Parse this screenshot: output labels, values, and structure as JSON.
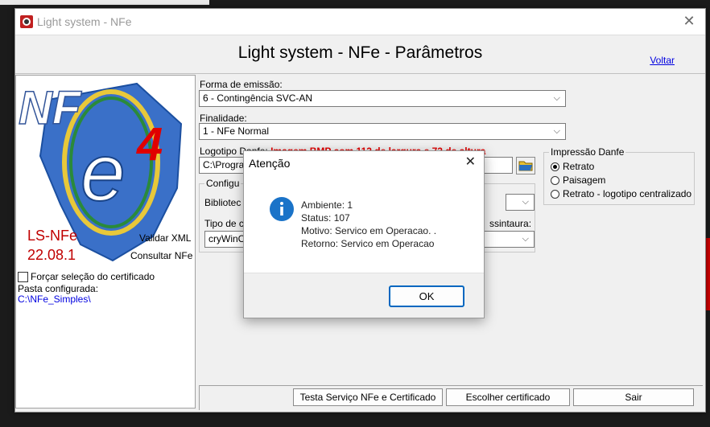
{
  "window": {
    "title": "Light system - NFe"
  },
  "header": {
    "title": "Light system - NFe - Parâmetros",
    "back_link": "Voltar"
  },
  "logo": {
    "big": "NF",
    "version_digit": "4",
    "product": "LS-NFe",
    "version": "22.08.1",
    "validate_link": "Validar XML",
    "consult_link": "Consultar NFe"
  },
  "left": {
    "force_cert": "Forçar seleção do certificado",
    "folder_label": "Pasta configurada:",
    "folder_value": "C:\\NFe_Simples\\"
  },
  "form": {
    "emissao_label": "Forma de emissão:",
    "emissao_value": "6 - Contingência SVC-AN",
    "finalidade_label": "Finalidade:",
    "finalidade_value": "1 - NFe Normal",
    "logotipo_label": "Logotipo Danfe:",
    "logotipo_hint": "Imagem BMP com 112 de largura e 72 de altura",
    "logotipo_path": "C:\\Progra",
    "config_group": "Configu",
    "biblioteca_label": "Bibliotec",
    "tipo_label": "Tipo de c",
    "assinatura_label": "ssintaura:",
    "assinatura_value": "cryWinC"
  },
  "danfe": {
    "title": "Impressão Danfe",
    "options": [
      "Retrato",
      "Paisagem",
      "Retrato - logotipo centralizado"
    ],
    "selected": 0
  },
  "buttons": {
    "test": "Testa Serviço NFe e Certificado",
    "choose_cert": "Escolher certificado",
    "exit": "Sair"
  },
  "dialog": {
    "title": "Atenção",
    "lines": [
      "Ambiente: 1",
      "Status: 107",
      "Motivo: Servico em Operacao. .",
      "Retorno: Servico em Operacao"
    ],
    "ok": "OK"
  },
  "colors": {
    "accent": "#0067c0",
    "link": "#0000e0",
    "warning": "#e00000"
  }
}
